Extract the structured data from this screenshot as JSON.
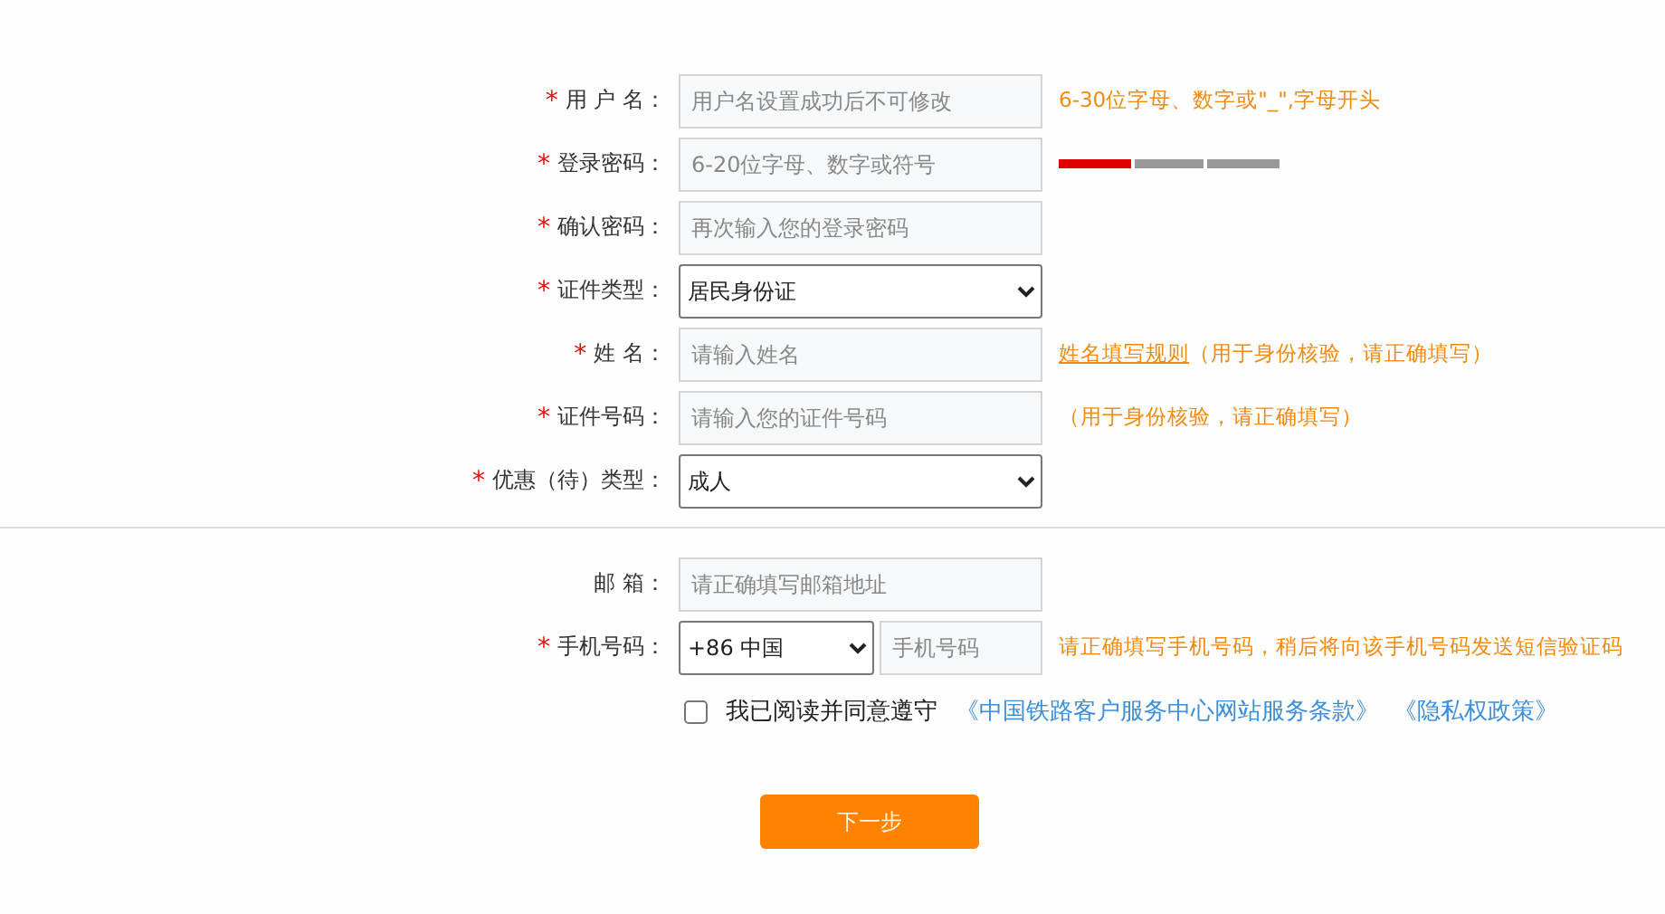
{
  "form": {
    "sections": [
      {
        "rows": [
          {
            "kind": "input",
            "mark": "*",
            "label": "用 户 名：",
            "placeholder": "用户名设置成功后不可修改",
            "note": {
              "kind": "hint",
              "text": "6-30位字母、数字或\"_\",字母开头"
            }
          },
          {
            "kind": "input",
            "mark": "*",
            "label": "登录密码：",
            "placeholder": "6-20位字母、数字或符号",
            "note": {
              "kind": "meter",
              "level": 0.333
            }
          },
          {
            "kind": "input",
            "mark": "*",
            "label": "确认密码：",
            "placeholder": "再次输入您的登录密码"
          },
          {
            "kind": "select",
            "mark": "*",
            "label": "证件类型：",
            "value": "居民身份证"
          },
          {
            "kind": "input",
            "mark": "*",
            "label": "姓 名：",
            "placeholder": "请输入姓名",
            "note": {
              "kind": "link",
              "link": "姓名填写规则",
              "text": "（用于身份核验，请正确填写）"
            }
          },
          {
            "kind": "input",
            "mark": "*",
            "label": "证件号码：",
            "placeholder": "请输入您的证件号码",
            "note": {
              "kind": "hint",
              "text": "（用于身份核验，请正确填写）"
            }
          },
          {
            "kind": "select",
            "mark": "*",
            "label": "优惠（待）类型：",
            "value": "成人"
          }
        ]
      },
      {
        "rows": [
          {
            "kind": "input",
            "label": "邮 箱：",
            "placeholder": "请正确填写邮箱地址"
          },
          {
            "kind": "phone",
            "mark": "*",
            "label": "手机号码：",
            "value": "+86 中国",
            "placeholder": "手机号码",
            "note": {
              "kind": "hint",
              "text": "请正确填写手机号码，稍后将向该手机号码发送短信验证码"
            }
          }
        ]
      }
    ],
    "agreement": {
      "checked": false,
      "text": "我已阅读并同意遵守",
      "links": [
        "《中国铁路客户服务中心网站服务条款》",
        "《隐私权政策》"
      ]
    },
    "button": "下一步"
  }
}
